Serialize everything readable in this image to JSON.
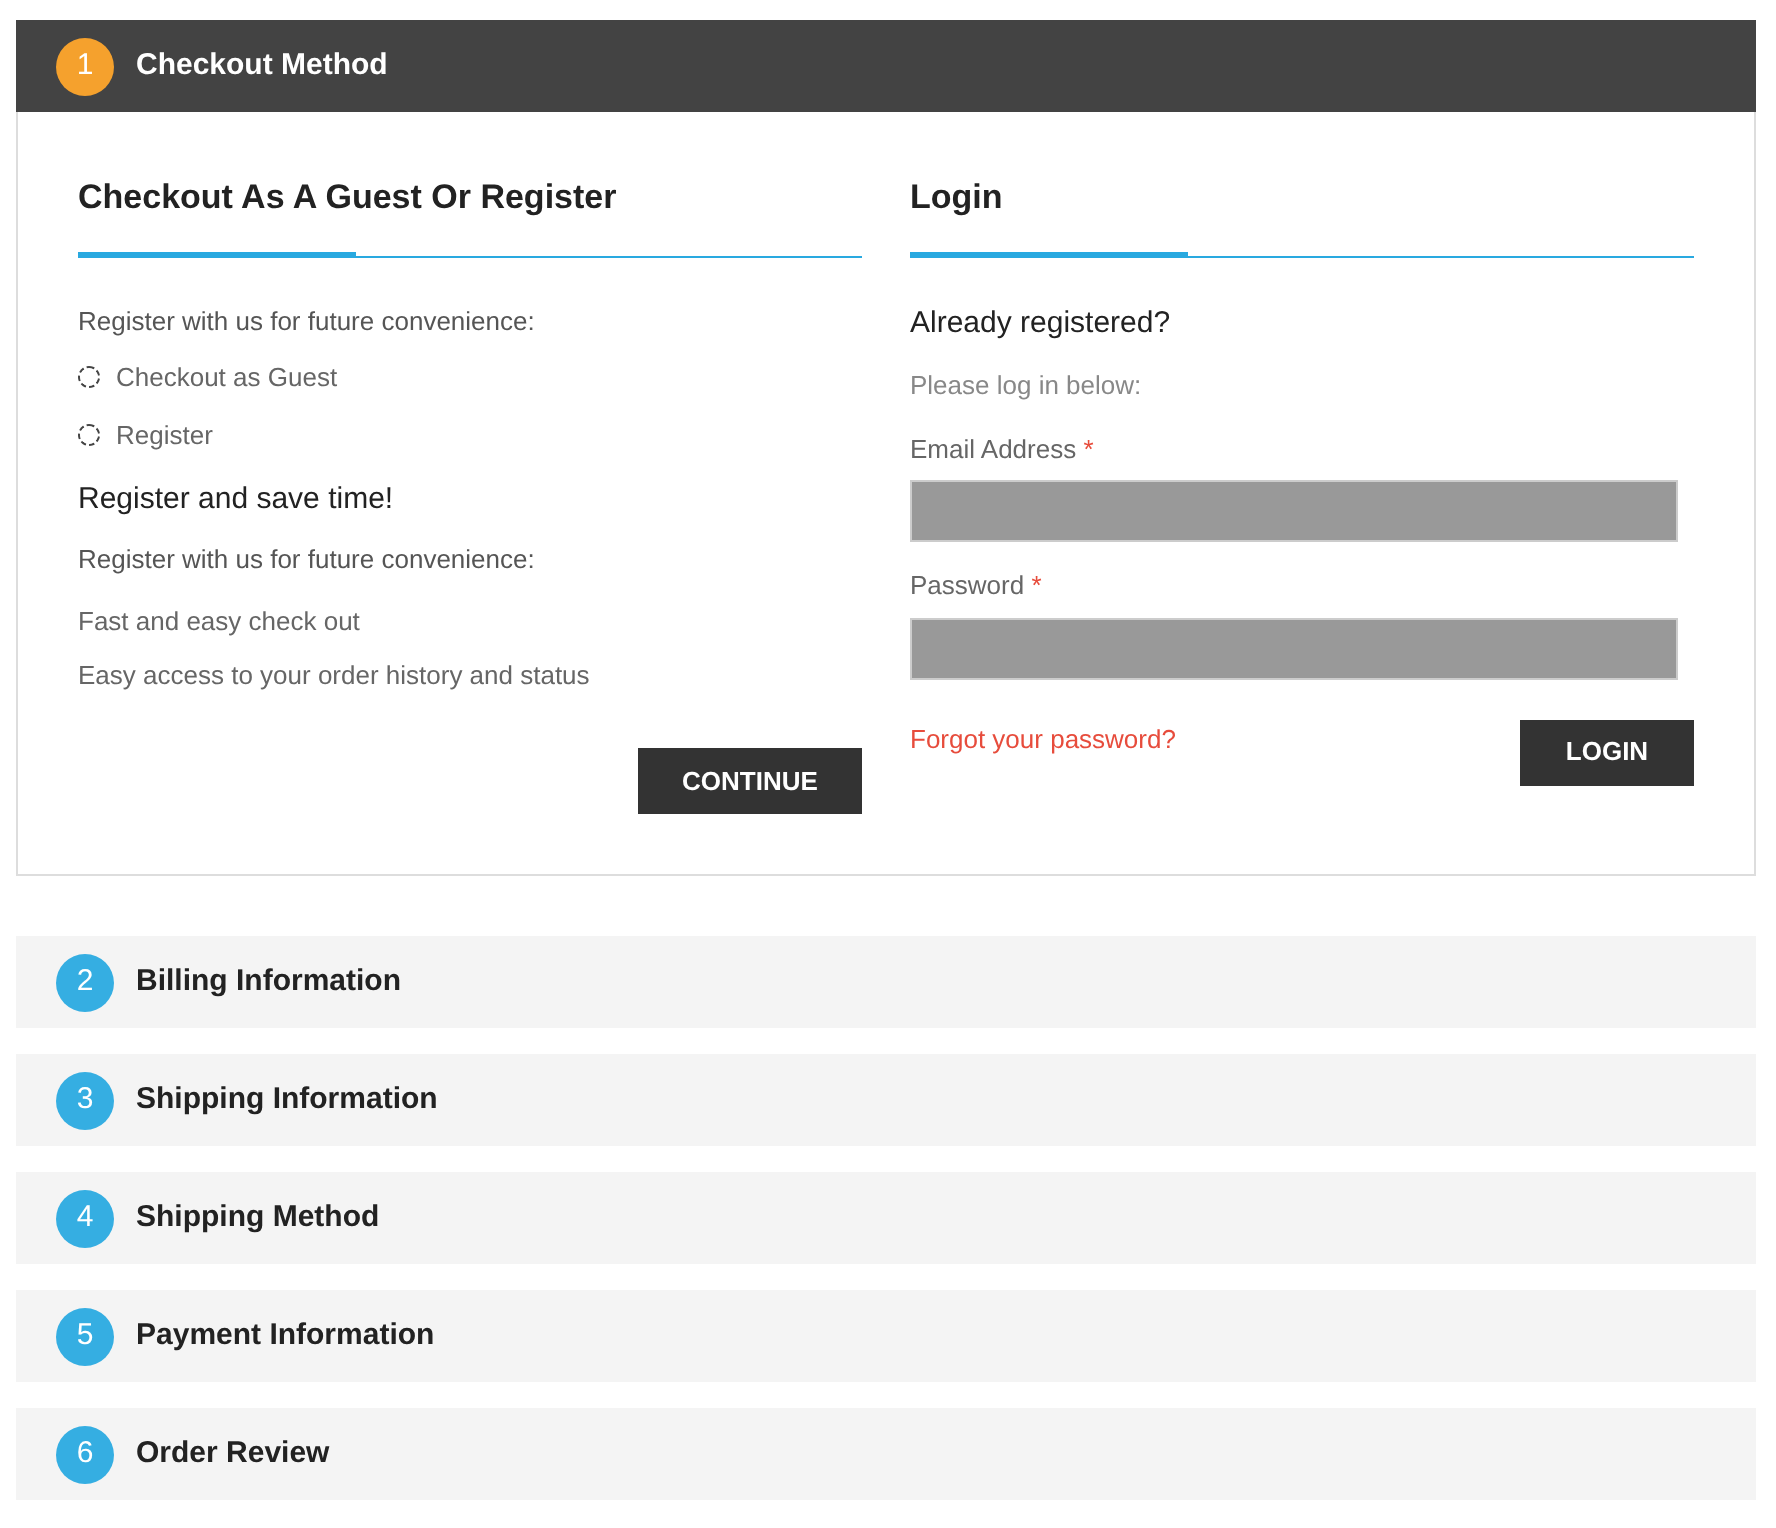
{
  "steps": [
    {
      "number": "1",
      "title": "Checkout Method",
      "expanded": true
    },
    {
      "number": "2",
      "title": "Billing Information",
      "expanded": false
    },
    {
      "number": "3",
      "title": "Shipping Information",
      "expanded": false
    },
    {
      "number": "4",
      "title": "Shipping Method",
      "expanded": false
    },
    {
      "number": "5",
      "title": "Payment Information",
      "expanded": false
    },
    {
      "number": "6",
      "title": "Order Review",
      "expanded": false
    }
  ],
  "guest": {
    "heading": "Checkout As A Guest Or Register",
    "intro": "Register with us for future convenience:",
    "options": [
      {
        "label": "Checkout as Guest",
        "selected": false
      },
      {
        "label": "Register",
        "selected": false
      }
    ],
    "subheading": "Register and save time!",
    "subintro": "Register with us for future convenience:",
    "benefits": [
      "Fast and easy check out",
      "Easy access to your order history and status"
    ],
    "button": "CONTINUE"
  },
  "login": {
    "heading": "Login",
    "question": "Already registered?",
    "hint": "Please log in below:",
    "fields": [
      {
        "label": "Email Address",
        "required": "*"
      },
      {
        "label": "Password",
        "required": "*"
      }
    ],
    "forgot": "Forgot your password?",
    "button": "LOGIN"
  }
}
